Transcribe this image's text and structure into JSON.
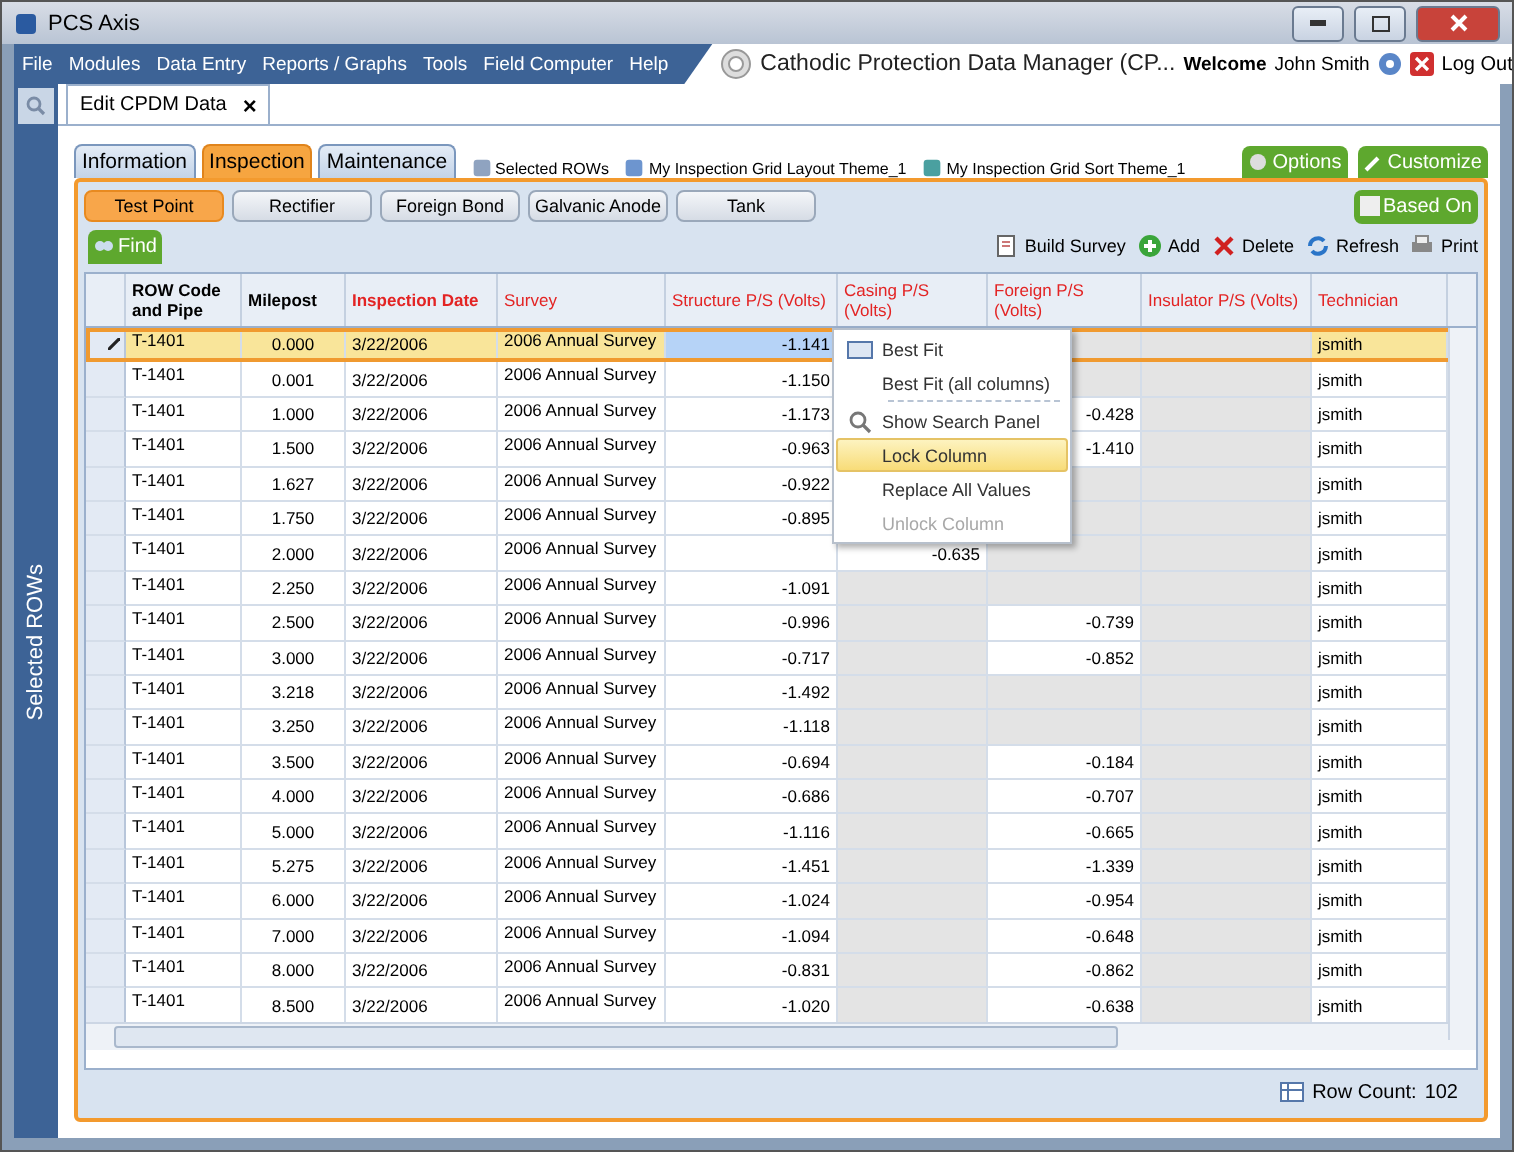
{
  "window": {
    "title": "PCS Axis"
  },
  "menu": [
    "File",
    "Modules",
    "Data Entry",
    "Reports / Graphs",
    "Tools",
    "Field Computer",
    "Help"
  ],
  "app_title": "Cathodic Protection Data Manager (CP...",
  "user": {
    "welcome": "Welcome",
    "name": "John Smith",
    "logout": "Log Out"
  },
  "doc_tab": {
    "label": "Edit CPDM Data",
    "close": "×"
  },
  "side_panel": {
    "label": "Selected ROWs"
  },
  "tabs": [
    {
      "label": "Information",
      "selected": false
    },
    {
      "label": "Inspection",
      "selected": true
    },
    {
      "label": "Maintenance",
      "selected": false
    }
  ],
  "themes": [
    "Selected ROWs",
    "My Inspection Grid Layout Theme_1",
    "My Inspection Grid Sort Theme_1"
  ],
  "top_buttons": [
    "Options",
    "Customize"
  ],
  "subtabs": [
    {
      "label": "Test Point",
      "selected": true
    },
    {
      "label": "Rectifier",
      "selected": false
    },
    {
      "label": "Foreign Bond",
      "selected": false
    },
    {
      "label": "Galvanic Anode",
      "selected": false
    },
    {
      "label": "Tank",
      "selected": false
    }
  ],
  "based_on": "Based On",
  "find": "Find",
  "toolbar": [
    {
      "kind": "build",
      "label": "Build Survey"
    },
    {
      "kind": "add",
      "label": "Add"
    },
    {
      "kind": "delete",
      "label": "Delete"
    },
    {
      "kind": "refresh",
      "label": "Refresh"
    },
    {
      "kind": "print",
      "label": "Print"
    }
  ],
  "table": {
    "columns": [
      {
        "label": "ROW Code and Pipe",
        "required": false,
        "bold": true
      },
      {
        "label": "Milepost",
        "required": false,
        "bold": true
      },
      {
        "label": "Inspection Date",
        "required": true,
        "bold": true
      },
      {
        "label": "Survey",
        "required": true,
        "bold": false
      },
      {
        "label": "Structure P/S (Volts)",
        "required": true,
        "bold": false
      },
      {
        "label": "Casing P/S (Volts)",
        "required": true,
        "bold": false
      },
      {
        "label": "Foreign P/S (Volts)",
        "required": true,
        "bold": false
      },
      {
        "label": "Insulator P/S (Volts)",
        "required": true,
        "bold": false
      },
      {
        "label": "Technician",
        "required": true,
        "bold": false
      }
    ],
    "rows": [
      {
        "selected": true,
        "row": "T-1401",
        "milepost": "0.000",
        "date": "3/22/2006",
        "survey": "2006 Annual Survey",
        "structure": "-1.141",
        "technician": "jsmith"
      },
      {
        "selected": false,
        "row": "T-1401",
        "milepost": "0.001",
        "date": "3/22/2006",
        "survey": "2006 Annual Survey",
        "structure": "-1.150",
        "technician": "jsmith"
      },
      {
        "selected": false,
        "row": "T-1401",
        "milepost": "1.000",
        "date": "3/22/2006",
        "survey": "2006 Annual Survey",
        "structure": "-1.173",
        "foreign": "-0.428",
        "technician": "jsmith"
      },
      {
        "selected": false,
        "row": "T-1401",
        "milepost": "1.500",
        "date": "3/22/2006",
        "survey": "2006 Annual Survey",
        "structure": "-0.963",
        "foreign": "-1.410",
        "technician": "jsmith"
      },
      {
        "selected": false,
        "row": "T-1401",
        "milepost": "1.627",
        "date": "3/22/2006",
        "survey": "2006 Annual Survey",
        "structure": "-0.922",
        "technician": "jsmith"
      },
      {
        "selected": false,
        "row": "T-1401",
        "milepost": "1.750",
        "date": "3/22/2006",
        "survey": "2006 Annual Survey",
        "structure": "-0.895",
        "technician": "jsmith"
      },
      {
        "selected": false,
        "row": "T-1401",
        "milepost": "2.000",
        "date": "3/22/2006",
        "survey": "2006 Annual Survey",
        "casing": "-0.635",
        "technician": "jsmith"
      },
      {
        "selected": false,
        "row": "T-1401",
        "milepost": "2.250",
        "date": "3/22/2006",
        "survey": "2006 Annual Survey",
        "structure": "-1.091",
        "technician": "jsmith"
      },
      {
        "selected": false,
        "row": "T-1401",
        "milepost": "2.500",
        "date": "3/22/2006",
        "survey": "2006 Annual Survey",
        "structure": "-0.996",
        "foreign": "-0.739",
        "technician": "jsmith"
      },
      {
        "selected": false,
        "row": "T-1401",
        "milepost": "3.000",
        "date": "3/22/2006",
        "survey": "2006 Annual Survey",
        "structure": "-0.717",
        "foreign": "-0.852",
        "technician": "jsmith"
      },
      {
        "selected": false,
        "row": "T-1401",
        "milepost": "3.218",
        "date": "3/22/2006",
        "survey": "2006 Annual Survey",
        "structure": "-1.492",
        "technician": "jsmith"
      },
      {
        "selected": false,
        "row": "T-1401",
        "milepost": "3.250",
        "date": "3/22/2006",
        "survey": "2006 Annual Survey",
        "structure": "-1.118",
        "technician": "jsmith"
      },
      {
        "selected": false,
        "row": "T-1401",
        "milepost": "3.500",
        "date": "3/22/2006",
        "survey": "2006 Annual Survey",
        "structure": "-0.694",
        "foreign": "-0.184",
        "technician": "jsmith"
      },
      {
        "selected": false,
        "row": "T-1401",
        "milepost": "4.000",
        "date": "3/22/2006",
        "survey": "2006 Annual Survey",
        "structure": "-0.686",
        "foreign": "-0.707",
        "technician": "jsmith"
      },
      {
        "selected": false,
        "row": "T-1401",
        "milepost": "5.000",
        "date": "3/22/2006",
        "survey": "2006 Annual Survey",
        "structure": "-1.116",
        "foreign": "-0.665",
        "technician": "jsmith"
      },
      {
        "selected": false,
        "row": "T-1401",
        "milepost": "5.275",
        "date": "3/22/2006",
        "survey": "2006 Annual Survey",
        "structure": "-1.451",
        "foreign": "-1.339",
        "technician": "jsmith"
      },
      {
        "selected": false,
        "row": "T-1401",
        "milepost": "6.000",
        "date": "3/22/2006",
        "survey": "2006 Annual Survey",
        "structure": "-1.024",
        "foreign": "-0.954",
        "technician": "jsmith"
      },
      {
        "selected": false,
        "row": "T-1401",
        "milepost": "7.000",
        "date": "3/22/2006",
        "survey": "2006 Annual Survey",
        "structure": "-1.094",
        "foreign": "-0.648",
        "technician": "jsmith"
      },
      {
        "selected": false,
        "row": "T-1401",
        "milepost": "8.000",
        "date": "3/22/2006",
        "survey": "2006 Annual Survey",
        "structure": "-0.831",
        "foreign": "-0.862",
        "technician": "jsmith"
      },
      {
        "selected": false,
        "row": "T-1401",
        "milepost": "8.500",
        "date": "3/22/2006",
        "survey": "2006 Annual Survey",
        "structure": "-1.020",
        "foreign": "-0.638",
        "technician": "jsmith"
      }
    ]
  },
  "context_menu": [
    {
      "label": "Best Fit",
      "icon": true,
      "highlighted": false,
      "disabled": false
    },
    {
      "label": "Best Fit (all columns)",
      "icon": false,
      "highlighted": false,
      "disabled": false
    },
    {
      "label": "Show Search Panel",
      "icon": true,
      "highlighted": false,
      "disabled": false
    },
    {
      "label": "Lock Column",
      "icon": false,
      "highlighted": true,
      "disabled": false
    },
    {
      "label": "Replace All Values",
      "icon": false,
      "highlighted": false,
      "disabled": false
    },
    {
      "label": "Unlock Column",
      "icon": false,
      "highlighted": false,
      "disabled": true
    }
  ],
  "footer": {
    "label": "Row Count:",
    "value": "102"
  }
}
